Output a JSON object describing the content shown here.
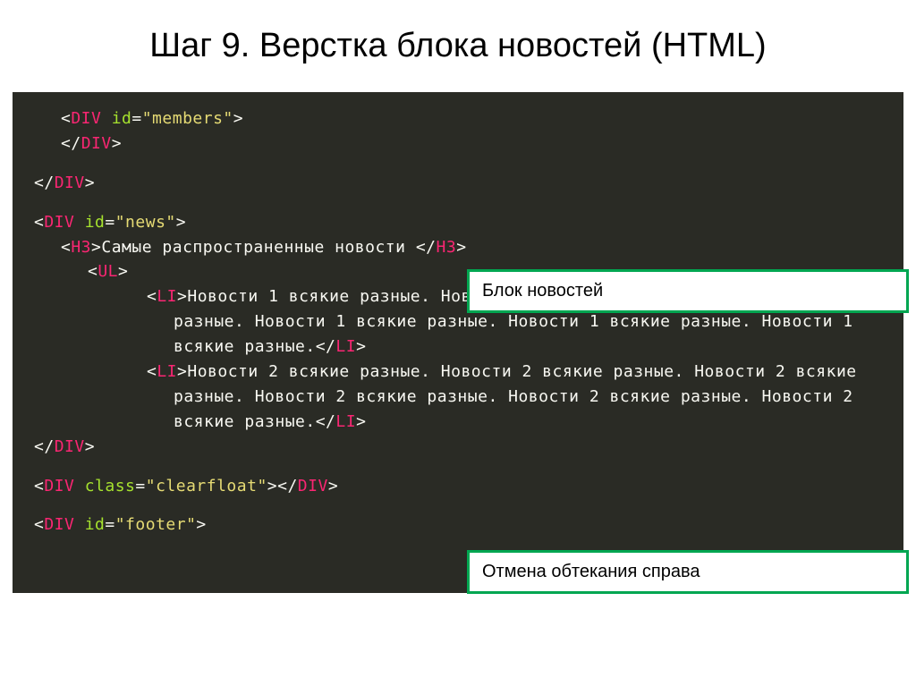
{
  "title": "Шаг 9. Верстка блока новостей (HTML)",
  "annotations": {
    "label1": "Блок новостей",
    "label2": "Отмена обтекания справа"
  },
  "code": {
    "l1_open": "<",
    "l1_tag": "div",
    "l1_attr": " id",
    "l1_eq": "=",
    "l1_str": "\"members\"",
    "l1_close": ">",
    "l2_open": "</",
    "l2_tag": "div",
    "l2_close": ">",
    "l3_open": "</",
    "l3_tag": "div",
    "l3_close": ">",
    "l4_open": "<",
    "l4_tag": "div",
    "l4_attr": " id",
    "l4_eq": "=",
    "l4_str": "\"news\"",
    "l4_close": ">",
    "l5_open": "<",
    "l5_tag": "h3",
    "l5_close": ">",
    "l5_txt": "Самые распространенные новости ",
    "l5_open2": "</",
    "l5_tag2": "h3",
    "l5_close2": ">",
    "l6_open": "<",
    "l6_tag": "ul",
    "l6_close": ">",
    "l7_open": "<",
    "l7_tag": "li",
    "l7_close": ">",
    "l7_txt": "Новости 1 всякие разные. Новости 1 всякие разные. Новости 1 всякие разные. Новости 1 всякие разные. Новости 1 всякие разные. Новости 1 всякие разные.",
    "l7_open2": "</",
    "l7_tag2": "li",
    "l7_close2": ">",
    "l8_open": "<",
    "l8_tag": "li",
    "l8_close": ">",
    "l8_txt": "Новости 2 всякие разные. Новости 2 всякие разные. Новости 2 всякие разные. Новости 2 всякие разные. Новости 2 всякие разные. Новости 2 всякие разные.",
    "l8_open2": "</",
    "l8_tag2": "li",
    "l8_close2": ">",
    "l9_open": "</",
    "l9_tag": "div",
    "l9_close": ">",
    "l10_open": "<",
    "l10_tag": "div",
    "l10_attr": " class",
    "l10_eq": "=",
    "l10_str": "\"clearfloat\"",
    "l10_close": "></",
    "l10_tag2": "div",
    "l10_close2": ">",
    "l11_open": "<",
    "l11_tag": "div",
    "l11_attr": " id",
    "l11_eq": "=",
    "l11_str": "\"footer\"",
    "l11_close": ">"
  }
}
